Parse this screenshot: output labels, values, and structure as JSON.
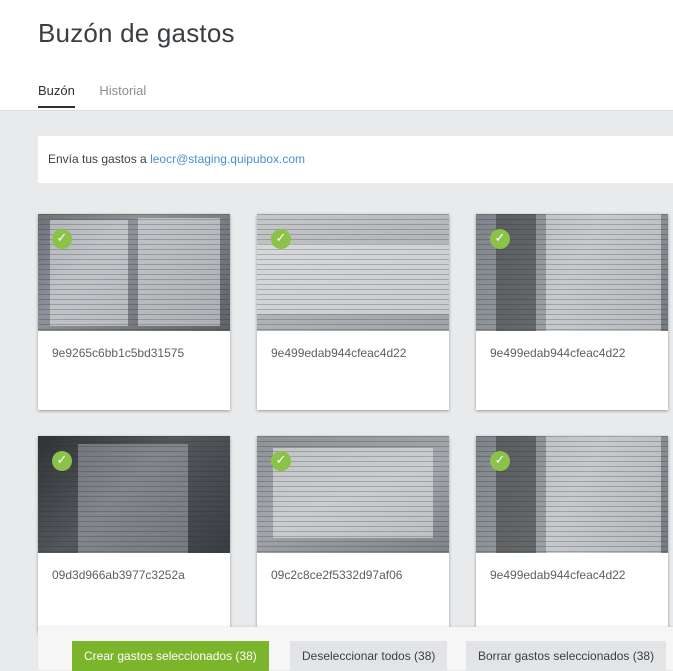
{
  "header": {
    "title": "Buzón de gastos",
    "tabs": [
      {
        "label": "Buzón",
        "active": true
      },
      {
        "label": "Historial",
        "active": false
      }
    ]
  },
  "info": {
    "text": "Envía tus gastos a ",
    "email": "leocr@staging.quipubox.com"
  },
  "cards": [
    {
      "label": "9e9265c6bb1c5bd31575",
      "selected": true
    },
    {
      "label": "9e499edab944cfeac4d22",
      "selected": true
    },
    {
      "label": "9e499edab944cfeac4d22",
      "selected": true
    },
    {
      "label": "09d3d966ab3977c3252a",
      "selected": true
    },
    {
      "label": "09c2c8ce2f5332d97af06",
      "selected": true
    },
    {
      "label": "9e499edab944cfeac4d22",
      "selected": true
    }
  ],
  "footer": {
    "create_label": "Crear gastos seleccionados (38)",
    "deselect_label": "Deseleccionar todos (38)",
    "delete_label": "Borrar gastos seleccionados (38)"
  },
  "colors": {
    "accent_green": "#7bb52c",
    "check_green": "#8bc34a",
    "link_blue": "#4a8fd6"
  }
}
